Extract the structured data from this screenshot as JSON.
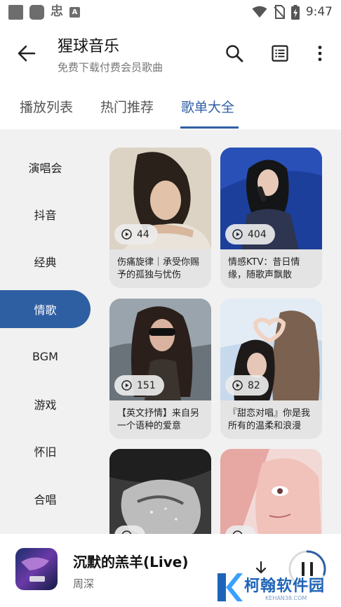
{
  "status_bar": {
    "time": "9:47",
    "left_icons": [
      "notification-square-icon",
      "notification-rounded-icon",
      "app-logo-icon",
      "a-badge-icon"
    ],
    "left_glyph": "忠",
    "left_badge": "A",
    "right_icons": [
      "wifi-icon",
      "no-sim-icon",
      "battery-charging-icon"
    ]
  },
  "app_bar": {
    "title": "猩球音乐",
    "subtitle": "免费下载付费会员歌曲",
    "actions": [
      "search-icon",
      "list-icon",
      "more-vert-icon"
    ]
  },
  "tabs": [
    {
      "label": "播放列表",
      "active": false
    },
    {
      "label": "热门推荐",
      "active": false
    },
    {
      "label": "歌单大全",
      "active": true
    }
  ],
  "categories": [
    {
      "label": "演唱会",
      "active": false
    },
    {
      "label": "抖音",
      "active": false
    },
    {
      "label": "经典",
      "active": false
    },
    {
      "label": "情歌",
      "active": true
    },
    {
      "label": "BGM",
      "active": false
    },
    {
      "label": "游戏",
      "active": false
    },
    {
      "label": "怀旧",
      "active": false
    },
    {
      "label": "合唱",
      "active": false
    }
  ],
  "playlists": [
    {
      "count": "44",
      "title": "伤痛旋律｜承受你赐予的孤独与忧伤"
    },
    {
      "count": "404",
      "title": "情感KTV：昔日情缘，随歌声飘散"
    },
    {
      "count": "151",
      "title": "【英文抒情】来自另一个语种的爱意"
    },
    {
      "count": "82",
      "title": "『甜恋对唱』你是我所有的温柔和浪漫"
    },
    {
      "count": "",
      "title": ""
    },
    {
      "count": "",
      "title": ""
    }
  ],
  "player": {
    "song": "沉默的羔羊(Live)",
    "artist": "周深",
    "progress": 0.3
  },
  "watermark": {
    "text": "柯翰软件园",
    "sub": "KEHAN38.COM"
  },
  "colors": {
    "accent": "#2f5fa3",
    "content_bg": "#f1f1f1",
    "card_bg": "#e4e4e4"
  }
}
